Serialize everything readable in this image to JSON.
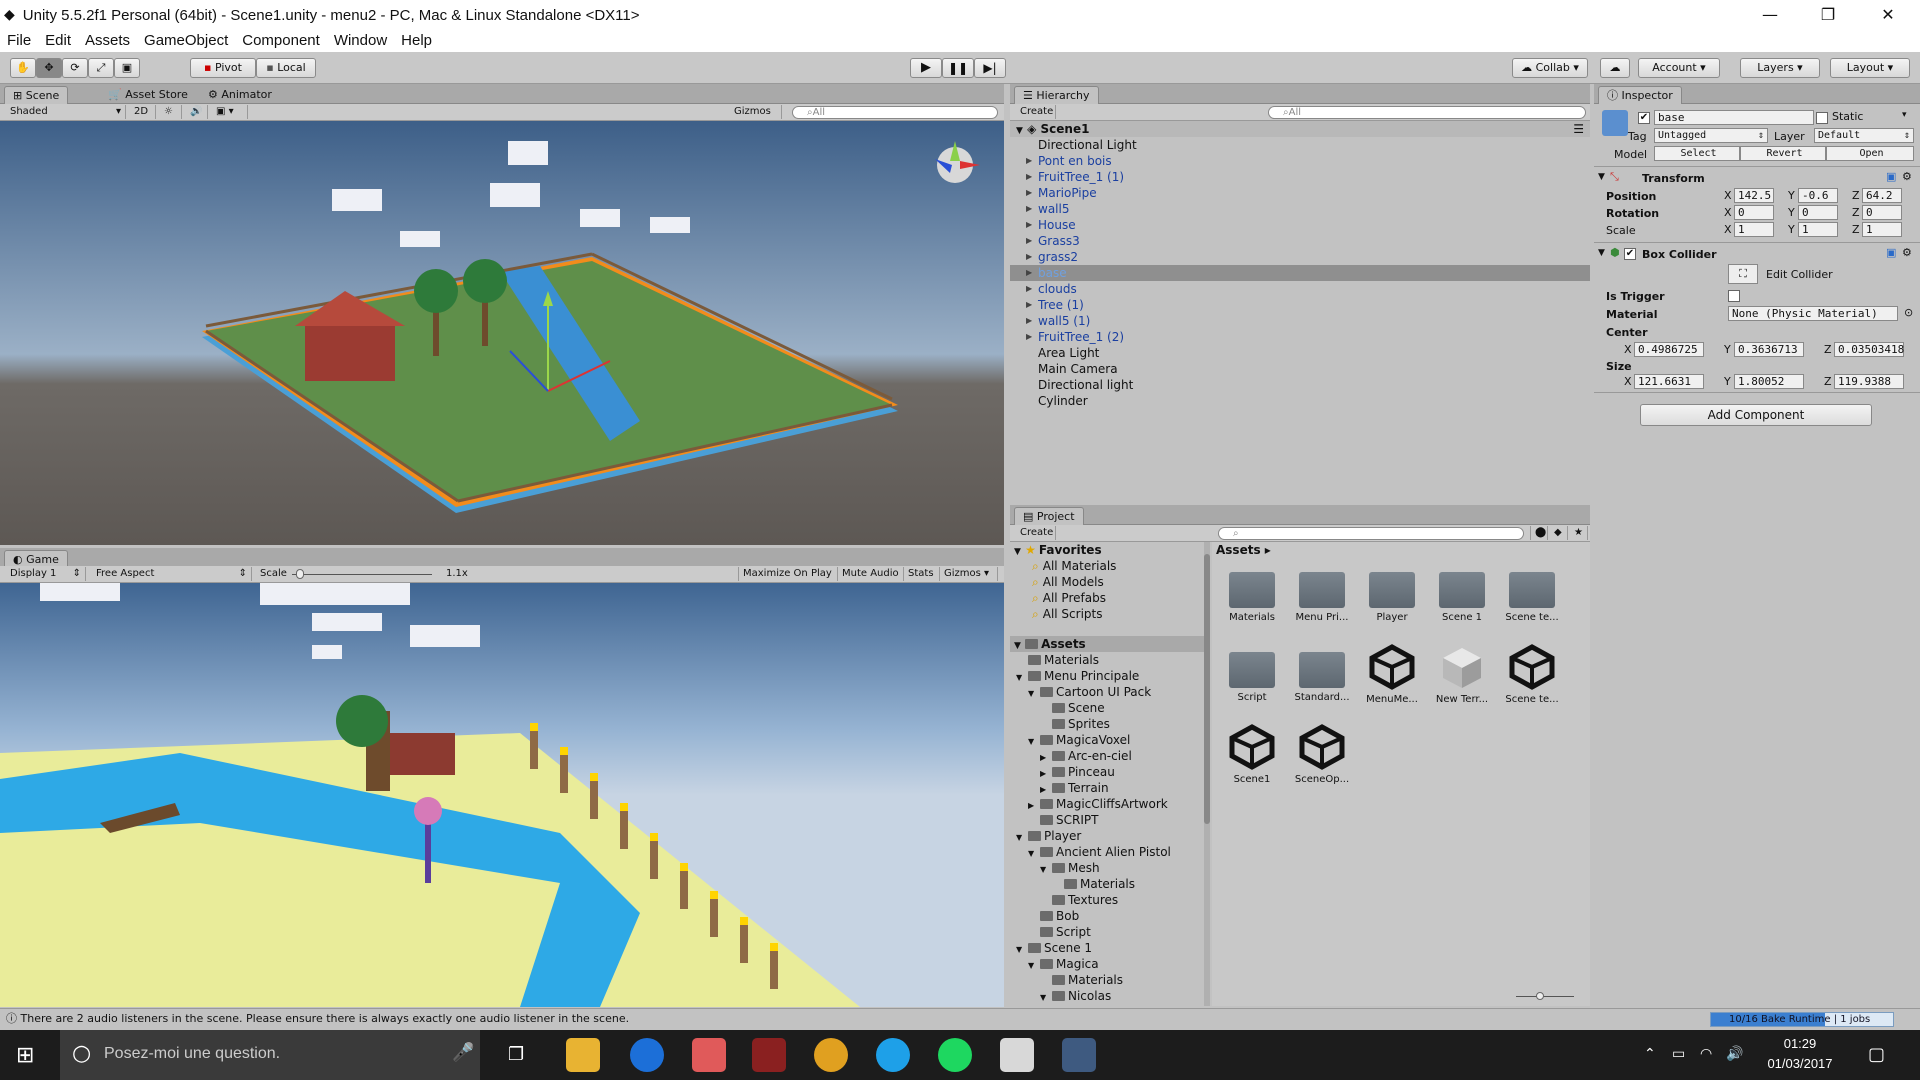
{
  "window": {
    "title": "Unity 5.5.2f1 Personal (64bit) - Scene1.unity - menu2 - PC, Mac & Linux Standalone <DX11>",
    "minimize": "—",
    "maximize": "❐",
    "close": "✕"
  },
  "menu": [
    "File",
    "Edit",
    "Assets",
    "GameObject",
    "Component",
    "Window",
    "Help"
  ],
  "toolbar": {
    "pivot": "Pivot",
    "local": "Local",
    "collab": "Collab ▾",
    "account": "Account",
    "layers": "Layers",
    "layout": "Layout"
  },
  "scene": {
    "tabs": [
      "Scene",
      "Asset Store",
      "Animator"
    ],
    "shaded": "Shaded",
    "mode2d": "2D",
    "gizmos": "Gizmos ▾",
    "search": "All"
  },
  "game": {
    "tab": "Game",
    "display": "Display 1",
    "aspect": "Free Aspect",
    "scale_label": "Scale",
    "scale_value": "1.1x",
    "buttons": [
      "Maximize On Play",
      "Mute Audio",
      "Stats",
      "Gizmos ▾"
    ]
  },
  "hierarchy": {
    "tab": "Hierarchy",
    "create": "Create ▾",
    "search": "All",
    "scene": "Scene1",
    "items": [
      {
        "name": "Directional Light",
        "arrow": false,
        "prefab": false
      },
      {
        "name": "Pont en bois",
        "arrow": true,
        "prefab": true
      },
      {
        "name": "FruitTree_1 (1)",
        "arrow": true,
        "prefab": true
      },
      {
        "name": "MarioPipe",
        "arrow": true,
        "prefab": true
      },
      {
        "name": "wall5",
        "arrow": true,
        "prefab": true
      },
      {
        "name": "House",
        "arrow": true,
        "prefab": true
      },
      {
        "name": "Grass3",
        "arrow": true,
        "prefab": true
      },
      {
        "name": "grass2",
        "arrow": true,
        "prefab": true
      },
      {
        "name": "base",
        "arrow": true,
        "prefab": true,
        "selected": true
      },
      {
        "name": "clouds",
        "arrow": true,
        "prefab": true
      },
      {
        "name": "Tree (1)",
        "arrow": true,
        "prefab": true
      },
      {
        "name": "wall5 (1)",
        "arrow": true,
        "prefab": true
      },
      {
        "name": "FruitTree_1 (2)",
        "arrow": true,
        "prefab": true
      },
      {
        "name": "Area Light",
        "arrow": false,
        "prefab": false
      },
      {
        "name": "Main Camera",
        "arrow": false,
        "prefab": false
      },
      {
        "name": "Directional light",
        "arrow": false,
        "prefab": false
      },
      {
        "name": "Cylinder",
        "arrow": false,
        "prefab": false
      }
    ]
  },
  "project": {
    "tab": "Project",
    "create": "Create ▾",
    "favorites_label": "Favorites",
    "favorites": [
      "All Materials",
      "All Models",
      "All Prefabs",
      "All Scripts"
    ],
    "assets_label": "Assets",
    "tree": [
      {
        "name": "Materials",
        "level": 1,
        "arrow": ""
      },
      {
        "name": "Menu Principale",
        "level": 1,
        "arrow": "▼"
      },
      {
        "name": "Cartoon UI Pack",
        "level": 2,
        "arrow": "▼"
      },
      {
        "name": "Scene",
        "level": 3,
        "arrow": ""
      },
      {
        "name": "Sprites",
        "level": 3,
        "arrow": ""
      },
      {
        "name": "MagicaVoxel",
        "level": 2,
        "arrow": "▼"
      },
      {
        "name": "Arc-en-ciel",
        "level": 3,
        "arrow": "▶"
      },
      {
        "name": "Pinceau",
        "level": 3,
        "arrow": "▶"
      },
      {
        "name": "Terrain",
        "level": 3,
        "arrow": "▶"
      },
      {
        "name": "MagicCliffsArtwork",
        "level": 2,
        "arrow": "▶"
      },
      {
        "name": "SCRIPT",
        "level": 2,
        "arrow": ""
      },
      {
        "name": "Player",
        "level": 1,
        "arrow": "▼"
      },
      {
        "name": "Ancient Alien Pistol",
        "level": 2,
        "arrow": "▼"
      },
      {
        "name": "Mesh",
        "level": 3,
        "arrow": "▼"
      },
      {
        "name": "Materials",
        "level": 4,
        "arrow": ""
      },
      {
        "name": "Textures",
        "level": 3,
        "arrow": ""
      },
      {
        "name": "Bob",
        "level": 2,
        "arrow": ""
      },
      {
        "name": "Script",
        "level": 2,
        "arrow": ""
      },
      {
        "name": "Scene 1",
        "level": 1,
        "arrow": "▼"
      },
      {
        "name": "Magica",
        "level": 2,
        "arrow": "▼"
      },
      {
        "name": "Materials",
        "level": 3,
        "arrow": ""
      },
      {
        "name": "Nicolas",
        "level": 3,
        "arrow": "▼"
      }
    ],
    "breadcrumb": "Assets ▸",
    "grid": [
      {
        "name": "Materials",
        "kind": "folder"
      },
      {
        "name": "Menu Pri...",
        "kind": "folder"
      },
      {
        "name": "Player",
        "kind": "folder"
      },
      {
        "name": "Scene 1",
        "kind": "folder"
      },
      {
        "name": "Scene te...",
        "kind": "folder"
      },
      {
        "name": "Script",
        "kind": "folder"
      },
      {
        "name": "Standard...",
        "kind": "folder"
      },
      {
        "name": "MenuMe...",
        "kind": "unity"
      },
      {
        "name": "New Terr...",
        "kind": "cube"
      },
      {
        "name": "Scene te...",
        "kind": "unity"
      },
      {
        "name": "Scene1",
        "kind": "unity"
      },
      {
        "name": "SceneOp...",
        "kind": "unity"
      }
    ]
  },
  "inspector": {
    "tab": "Inspector",
    "object_name": "base",
    "static_label": "Static",
    "tag_label": "Tag",
    "tag_value": "Untagged",
    "layer_label": "Layer",
    "layer_value": "Default",
    "model_label": "Model",
    "model_buttons": [
      "Select",
      "Revert",
      "Open"
    ],
    "transform": {
      "title": "Transform",
      "position_label": "Position",
      "rotation_label": "Rotation",
      "scale_label": "Scale",
      "position": [
        "142.5",
        "-0.6",
        "64.2"
      ],
      "rotation": [
        "0",
        "0",
        "0"
      ],
      "scale": [
        "1",
        "1",
        "1"
      ]
    },
    "box_collider": {
      "title": "Box Collider",
      "edit_label": "Edit Collider",
      "is_trigger_label": "Is Trigger",
      "material_label": "Material",
      "material_value": "None (Physic Material)",
      "center_label": "Center",
      "size_label": "Size",
      "center": [
        "0.4986725",
        "0.3636713",
        "0.03503418"
      ],
      "size": [
        "121.6631",
        "1.80052",
        "119.9388"
      ]
    },
    "add_component": "Add Component"
  },
  "status": {
    "message": "There are 2 audio listeners in the scene. Please ensure there is always exactly one audio listener in the scene.",
    "bake": "10/16 Bake Runtime | 1 jobs"
  },
  "taskbar": {
    "search": "Posez-moi une question.",
    "time": "01:29",
    "date": "01/03/2017"
  }
}
